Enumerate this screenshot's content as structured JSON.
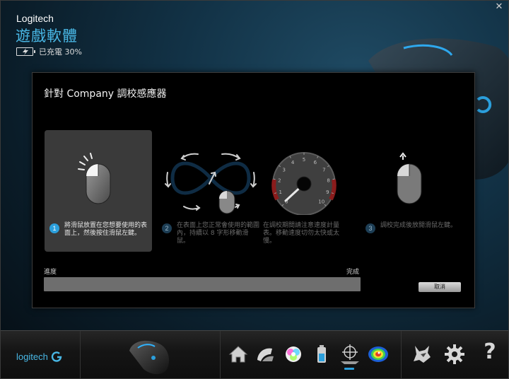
{
  "window": {
    "brand": "Logitech",
    "app_title": "遊戲軟體",
    "battery_text": "已充電 30%",
    "close_glyph": "✕"
  },
  "dialog": {
    "title": "針對 Company 調校感應器",
    "steps": [
      {
        "number": "1",
        "text": "將滑鼠放置在您想要使用的表面上，然後按住滑鼠左鍵。"
      },
      {
        "number": "2",
        "text": "在表面上您正常會使用的範圍內，持續以 8 字形移動滑鼠。"
      },
      {
        "number": "",
        "text": "在調校期間請注意速度計量表。移動速度切勿太快或太慢。"
      },
      {
        "number": "3",
        "text": "調校完成後放開滑鼠左鍵。"
      }
    ],
    "gauge_ticks": [
      "0",
      "1",
      "2",
      "3",
      "4",
      "5",
      "6",
      "7",
      "8",
      "9",
      "10"
    ],
    "progress_label": "進度",
    "progress_done_label": "完成",
    "progress_value": 0,
    "cancel_label": "取消"
  },
  "bottom_bar": {
    "logo_text": "logitech",
    "icons": [
      "home-icon",
      "pointer-settings-icon",
      "lighting-icon",
      "battery-icon",
      "surface-tuning-icon",
      "heatmap-icon",
      "community-icon",
      "settings-gear-icon",
      "help-icon"
    ],
    "help_glyph": "?"
  },
  "colors": {
    "accent": "#49b8e6",
    "active_step_bg": "#3a3a3a",
    "progress_track": "#6e6e6e"
  }
}
